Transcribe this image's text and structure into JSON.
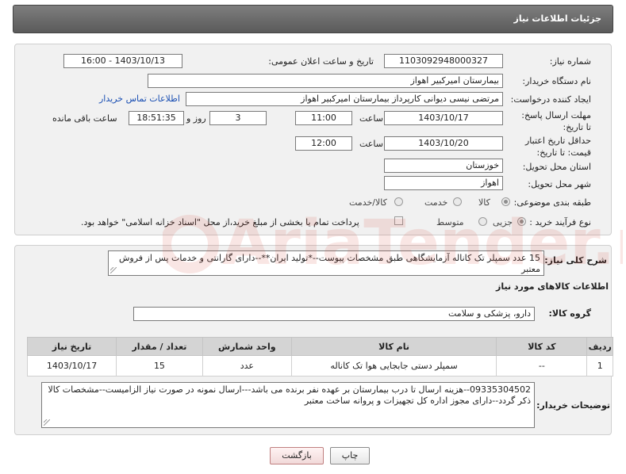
{
  "header": {
    "title": "جزئیات اطلاعات نیاز"
  },
  "form": {
    "need_number": {
      "label": "شماره نیاز:",
      "value": "1103092948000327"
    },
    "announce": {
      "label": "تاریخ و ساعت اعلان عمومی:",
      "value": "1403/10/13 - 16:00"
    },
    "buyer_org": {
      "label": "نام دستگاه خریدار:",
      "value": "بیمارستان امیرکبیر اهواز"
    },
    "requester": {
      "label": "ایجاد کننده درخواست:",
      "value": "مرتضی نیسی دیوانی کارپرداز بیمارستان امیرکبیر اهواز",
      "contact_link": "اطلاعات تماس خریدار"
    },
    "deadline": {
      "label": "مهلت ارسال پاسخ: تا تاریخ:",
      "date": "1403/10/17",
      "time_label": "ساعت",
      "time": "11:00",
      "days": "3",
      "days_label": "روز و",
      "remaining": "18:51:35",
      "remaining_label": "ساعت باقی مانده"
    },
    "validity": {
      "label": "حداقل تاریخ اعتبار قیمت: تا تاریخ:",
      "date": "1403/10/20",
      "time_label": "ساعت",
      "time": "12:00"
    },
    "province": {
      "label": "استان محل تحویل:",
      "value": "خوزستان"
    },
    "city": {
      "label": "شهر محل تحویل:",
      "value": "اهواز"
    },
    "category": {
      "label": "طبقه بندی موضوعی:",
      "options": [
        "کالا",
        "خدمت",
        "کالا/خدمت"
      ],
      "selected": "کالا"
    },
    "process": {
      "label": "نوع فرآیند خرید :",
      "options": [
        "جزیی",
        "متوسط"
      ],
      "selected": "جزیی",
      "payment_note": "پرداخت تمام یا بخشی از مبلغ خرید،از محل \"اسناد خزانه اسلامی\" خواهد بود."
    }
  },
  "description": {
    "label": "شرح کلی نیاز:",
    "text": "15 عدد سمپلر تک کاناله آزمایشگاهی طبق مشخصات پیوست--*تولید ایران**--دارای گارانتی و خدمات پس از فروش معتبر"
  },
  "goods": {
    "section_title": "اطلاعات کالاهای مورد نیاز",
    "group_label": "گروه کالا:",
    "group_value": "دارو، پزشکی و سلامت",
    "columns": [
      "ردیف",
      "کد کالا",
      "نام کالا",
      "واحد شمارش",
      "تعداد / مقدار",
      "تاریخ نیاز"
    ],
    "rows": [
      {
        "row": "1",
        "code": "--",
        "name": "سمپلر دستی جابجایی هوا تک کاناله",
        "unit": "عدد",
        "qty": "15",
        "date": "1403/10/17"
      }
    ]
  },
  "buyer_notes": {
    "label": "توضیحات خریدار:",
    "text": "09335304502--هزینه ارسال تا درب بیمارستان بر عهده نفر برنده می باشد---ارسال نمونه در صورت نیاز الزامیست--مشخصات کالا ذکر گردد--دارای مجوز اداره کل تجهیزات و پروانه ساخت معتبر"
  },
  "buttons": {
    "print": "چاپ",
    "back": "بازگشت"
  },
  "watermark": {
    "text": "AriaTender.net"
  },
  "colors": {
    "header_bg": "#6b6b6b",
    "link": "#1a4fb3",
    "back_button": "#f1d9d9",
    "watermark": "#d94a3a"
  }
}
